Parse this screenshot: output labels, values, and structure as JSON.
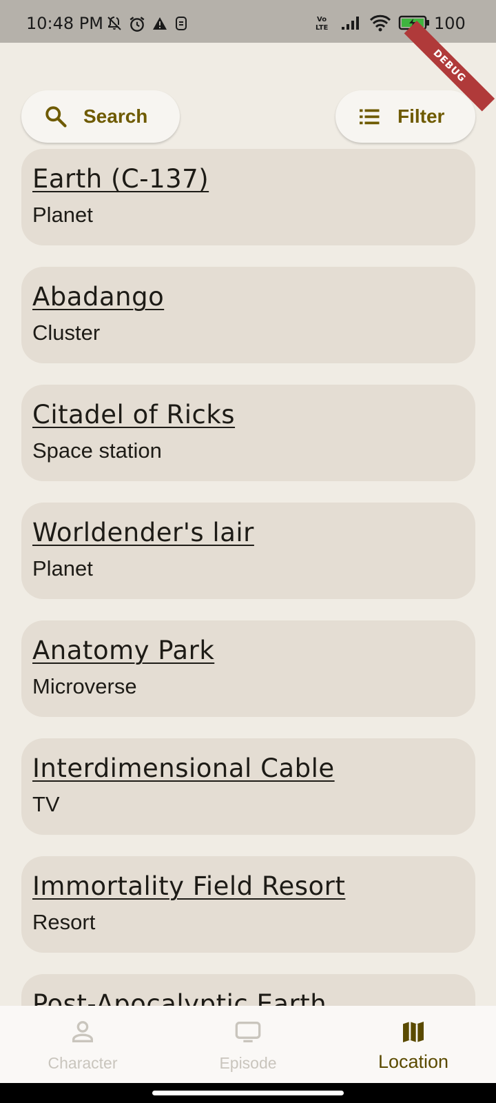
{
  "status_bar": {
    "time": "10:48 PM",
    "battery": "100",
    "debug_banner": "DEBUG",
    "icons": [
      "notifications-off-icon",
      "alarm-icon",
      "warning-icon",
      "sim-icon",
      "volte-icon",
      "signal-icon",
      "wifi-icon",
      "battery-charging-icon"
    ]
  },
  "toolbar": {
    "search_label": "Search",
    "filter_label": "Filter"
  },
  "locations": [
    {
      "name": "Earth (C-137)",
      "type": "Planet"
    },
    {
      "name": "Abadango",
      "type": "Cluster"
    },
    {
      "name": "Citadel of Ricks",
      "type": "Space station"
    },
    {
      "name": "Worldender's lair",
      "type": "Planet"
    },
    {
      "name": "Anatomy Park",
      "type": "Microverse"
    },
    {
      "name": "Interdimensional Cable",
      "type": "TV"
    },
    {
      "name": "Immortality Field Resort",
      "type": "Resort"
    },
    {
      "name": "Post-Apocalyptic Earth",
      "type": ""
    }
  ],
  "bottom_nav": {
    "items": [
      {
        "label": "Character",
        "icon": "person-icon",
        "active": false
      },
      {
        "label": "Episode",
        "icon": "tv-icon",
        "active": false
      },
      {
        "label": "Location",
        "icon": "map-icon",
        "active": true
      }
    ]
  },
  "colors": {
    "background": "#f0ece4",
    "card": "#e4ddd3",
    "accent": "#6e5a00",
    "inactive": "#c9c5bd"
  }
}
